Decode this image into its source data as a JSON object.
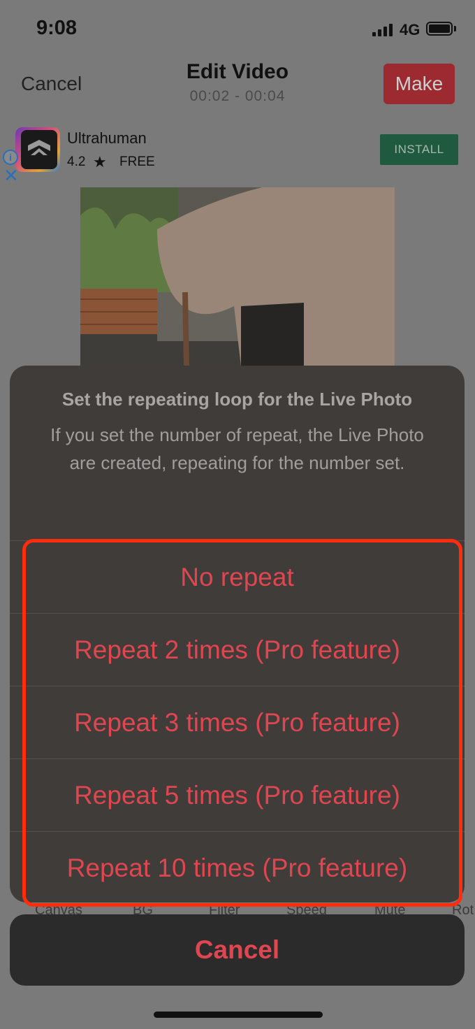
{
  "status": {
    "time": "9:08",
    "network": "4G"
  },
  "nav": {
    "cancel": "Cancel",
    "title": "Edit Video",
    "subtitle": "00:02 - 00:04",
    "make": "Make"
  },
  "ad": {
    "name": "Ultrahuman",
    "rating": "4.2",
    "star": "★",
    "price": "FREE",
    "install": "INSTALL",
    "info": "i",
    "close": "✕"
  },
  "toolbar": {
    "items": [
      "Canvas",
      "BG",
      "Filter",
      "Speed",
      "Mute",
      "Rot"
    ]
  },
  "sheet": {
    "title": "Set the repeating loop for the Live Photo",
    "message": "If you set the number of repeat, the Live Photo are created, repeating for the number set.",
    "options": [
      "No repeat",
      "Repeat 2 times (Pro feature)",
      "Repeat 3 times (Pro feature)",
      "Repeat 5 times (Pro feature)",
      "Repeat 10 times (Pro feature)"
    ],
    "cancel": "Cancel"
  },
  "colors": {
    "accent": "#e0464f",
    "highlight": "#ff2d0e",
    "make_button": "#9d2a31",
    "install_button": "#1f5a3f"
  }
}
